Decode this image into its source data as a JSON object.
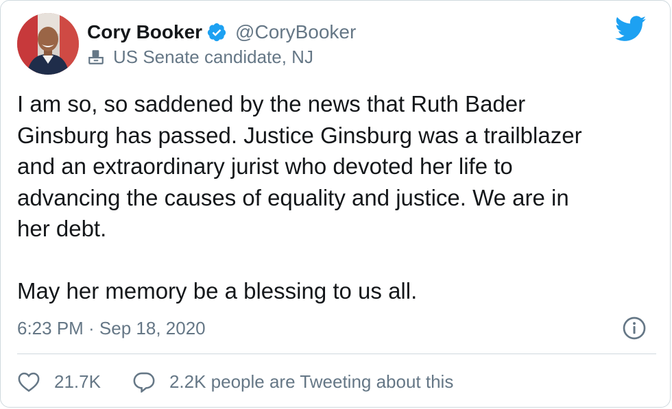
{
  "author": {
    "display_name": "Cory Booker",
    "handle": "@CoryBooker",
    "verified": true,
    "label": "US Senate candidate, NJ",
    "label_icon": "ballot-box-icon",
    "avatar_icon": "avatar"
  },
  "platform_icon": "twitter-bird-icon",
  "tweet": {
    "text": "I am so, so saddened by the news that Ruth Bader\nGinsburg has passed. Justice Ginsburg was a trailblazer\nand an extraordinary jurist who devoted her life to\nadvancing the causes of equality and justice. We are in\nher debt.\n\nMay her memory be a blessing to us all.",
    "timestamp": "6:23 PM · Sep 18, 2020"
  },
  "actions": {
    "likes": "21.7K",
    "like_icon": "heart-icon",
    "reply_icon": "speech-bubble-icon",
    "conversation": "2.2K people are Tweeting about this"
  },
  "info_icon": "info-icon",
  "colors": {
    "text": "#14171a",
    "secondary": "#657786",
    "twitter_blue": "#1da1f2",
    "border": "#cfd9de"
  }
}
